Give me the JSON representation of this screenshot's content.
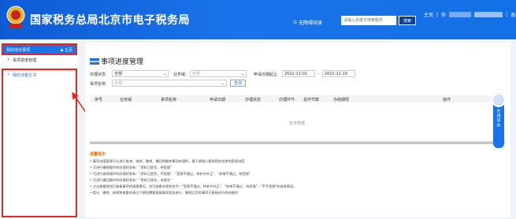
{
  "header": {
    "site_title": "国家税务总局北京市电子税务局",
    "accessibility": "无障碍阅读",
    "search_placeholder": "请输入关键字搜索服务",
    "search_button": "搜索",
    "nav_home": "主页",
    "nav_user": "你",
    "nav_logout": "退出",
    "colors": {
      "header_bg": "#1470e6",
      "accent": "#1a73e8",
      "annotation": "#e22222"
    }
  },
  "sidebar": {
    "active_item": "我的待办事项",
    "home_label": "◆ 主页",
    "sub_items": [
      "事项进度管理",
      "我的涉税文书"
    ]
  },
  "main": {
    "title": "事项进度管理",
    "filters": {
      "status_label": "办理状态:",
      "status_value": "全部",
      "business_label": "业务域:",
      "business_placeholder": "全部",
      "date_label": "申请日期起止:",
      "date_from": "2022-11-01",
      "date_sep": "-",
      "date_to": "2022-11-10",
      "item_label": "事项名称:",
      "item_placeholder": "全部",
      "query_button": "查询"
    },
    "table": {
      "columns": [
        "序号",
        "业务域",
        "事项名称",
        "申请日期",
        "办理状态",
        "办理环节",
        "总环节数",
        "办结期限",
        "操作"
      ],
      "empty_text": "暂无数据"
    },
    "tips": {
      "title": "温馨提示",
      "lines": [
        "• 事项进度管理可以进行查询、修改、撤销、撤回和删除事项申请的，便于纳税人跟进税务机关的受理进度",
        "• 可进行撤销操作的办理状态有：\"资料已提交，待受理\"",
        "• 可进行修改操作的办理状态有：\"资料已提交，不受理\"、\"受理不通过，待补齐补正\"、\"核审不通过，待受理\"",
        "• 可进行撤回操作的办理状态有：\"资料已保存，未提交\"",
        "• 点击查看按钮可查看事项的填报情况，也可查看办理状态为：\"受理不通过，待补齐补正\"、\"核审不通过，待受理\"、\"不予受理\"的具体原因。",
        "• 提示：撤销、修改和查看申请三个按钮需要根据事项状态进行，撤销之后的事项已直接进行终结操作"
      ]
    }
  },
  "float": {
    "label": "在线导办"
  }
}
